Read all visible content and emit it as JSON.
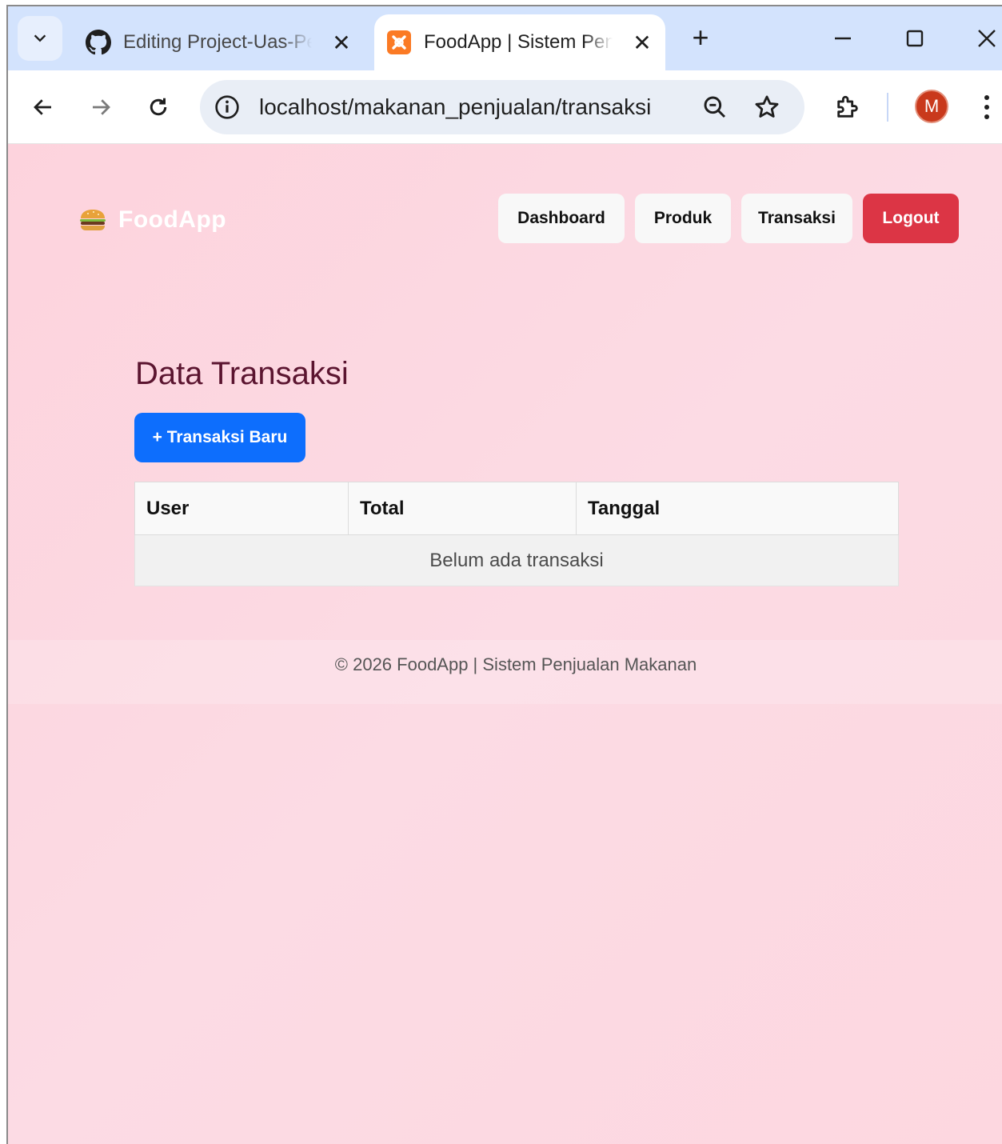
{
  "browser": {
    "tabs": [
      {
        "title": "Editing Project-Uas-Pe",
        "icon": "github-icon"
      },
      {
        "title": "FoodApp | Sistem Penj",
        "icon": "xampp-icon",
        "active": true
      }
    ],
    "url": "localhost/makanan_penjualan/transaksi",
    "profile_initial": "M"
  },
  "navbar": {
    "brand": "FoodApp",
    "items": [
      "Dashboard",
      "Produk",
      "Transaksi"
    ],
    "logout_label": "Logout"
  },
  "main": {
    "title": "Data Transaksi",
    "new_button": "+ Transaksi Baru",
    "table": {
      "columns": [
        "User",
        "Total",
        "Tanggal"
      ],
      "empty_message": "Belum ada transaksi"
    }
  },
  "footer": {
    "text": "© 2026 FoodApp | Sistem Penjualan Makanan"
  },
  "colors": {
    "page_bg": "#fbd9e1",
    "primary": "#0d6efd",
    "danger": "#dc3545",
    "heading": "#5b1530"
  }
}
